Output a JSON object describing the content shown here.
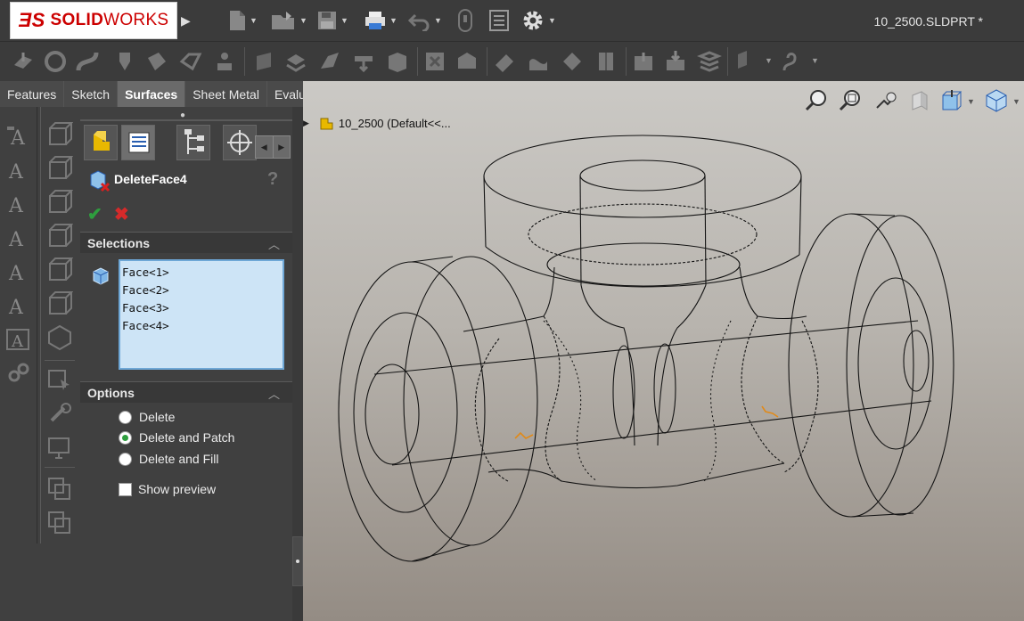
{
  "app": {
    "logo_ds": "ƎS",
    "logo_text_bold": "SOLID",
    "logo_text": "WORKS",
    "document_title": "10_2500.SLDPRT *"
  },
  "tabs": [
    {
      "label": "Features",
      "active": false
    },
    {
      "label": "Sketch",
      "active": false
    },
    {
      "label": "Surfaces",
      "active": true
    },
    {
      "label": "Sheet Metal",
      "active": false
    },
    {
      "label": "Evaluate",
      "active": false
    }
  ],
  "property_manager": {
    "feature_name": "DeleteFace4",
    "help_glyph": "?",
    "ok_glyph": "✔",
    "cancel_glyph": "✖",
    "selections": {
      "header": "Selections",
      "items": [
        "Face<1>",
        "Face<2>",
        "Face<3>",
        "Face<4>"
      ]
    },
    "options": {
      "header": "Options",
      "radios": [
        {
          "label": "Delete",
          "selected": false
        },
        {
          "label": "Delete and Patch",
          "selected": true
        },
        {
          "label": "Delete and Fill",
          "selected": false
        }
      ],
      "show_preview_label": "Show preview",
      "show_preview_checked": false
    }
  },
  "viewport": {
    "tree_label": "10_2500  (Default<<..."
  },
  "colors": {
    "accent_green": "#2e9e3e",
    "accent_red": "#cc0000",
    "selection_bg": "#cde4f6",
    "pick_marker": "#e08a1a"
  }
}
